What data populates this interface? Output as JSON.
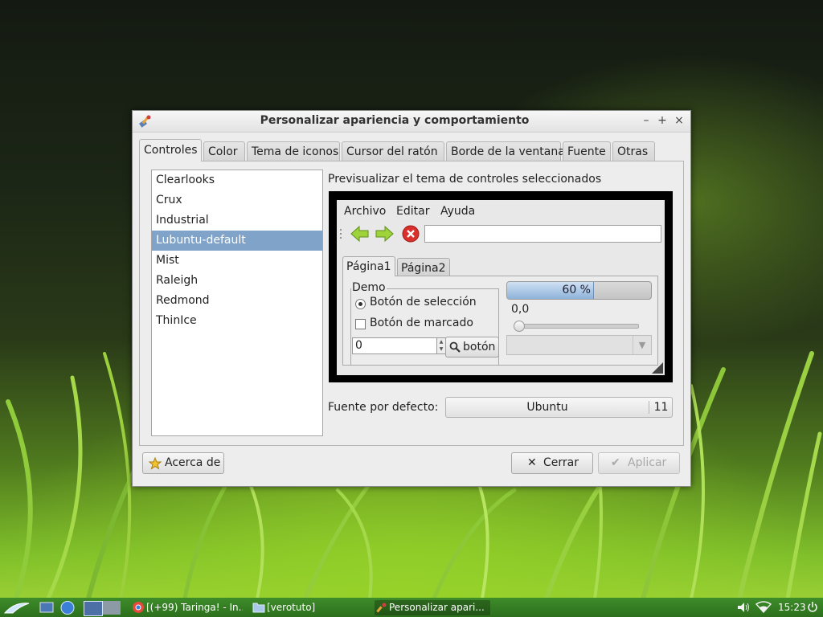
{
  "window": {
    "title": "Personalizar apariencia y comportamiento",
    "controls": {
      "minimize": "–",
      "maximize": "+",
      "close": "×"
    }
  },
  "tabs": [
    {
      "label": "Controles",
      "active": true
    },
    {
      "label": "Color"
    },
    {
      "label": "Tema de iconos"
    },
    {
      "label": "Cursor del ratón"
    },
    {
      "label": "Borde de la ventana"
    },
    {
      "label": "Fuente"
    },
    {
      "label": "Otras"
    }
  ],
  "themes": {
    "items": [
      "Clearlooks",
      "Crux",
      "Industrial",
      "Lubuntu-default",
      "Mist",
      "Raleigh",
      "Redmond",
      "ThinIce"
    ],
    "selected": "Lubuntu-default"
  },
  "preview": {
    "label": "Previsualizar el tema de controles seleccionados",
    "menu": [
      "Archivo",
      "Editar",
      "Ayuda"
    ],
    "tabs": [
      "Página1",
      "Página2"
    ],
    "demo_legend": "Demo",
    "radio_label": "Botón de selección",
    "check_label": "Botón de marcado",
    "spin_value": "0",
    "button_label": "botón",
    "progress_text": "60 %",
    "progress_fraction": 0.6,
    "slider_value": "0,0"
  },
  "font": {
    "label": "Fuente por defecto:",
    "name": "Ubuntu",
    "size": "11"
  },
  "buttons": {
    "about": "Acerca de",
    "close": "Cerrar",
    "apply": "Aplicar"
  },
  "taskbar": {
    "items": [
      "[(+99) Taringa! - In...",
      "[verotuto]",
      "Personalizar apari..."
    ],
    "clock": "15:23"
  },
  "colors": {
    "selection": "#7fa3c9",
    "taskbar": "#2c6f1d",
    "progress": "#8fb3da"
  }
}
